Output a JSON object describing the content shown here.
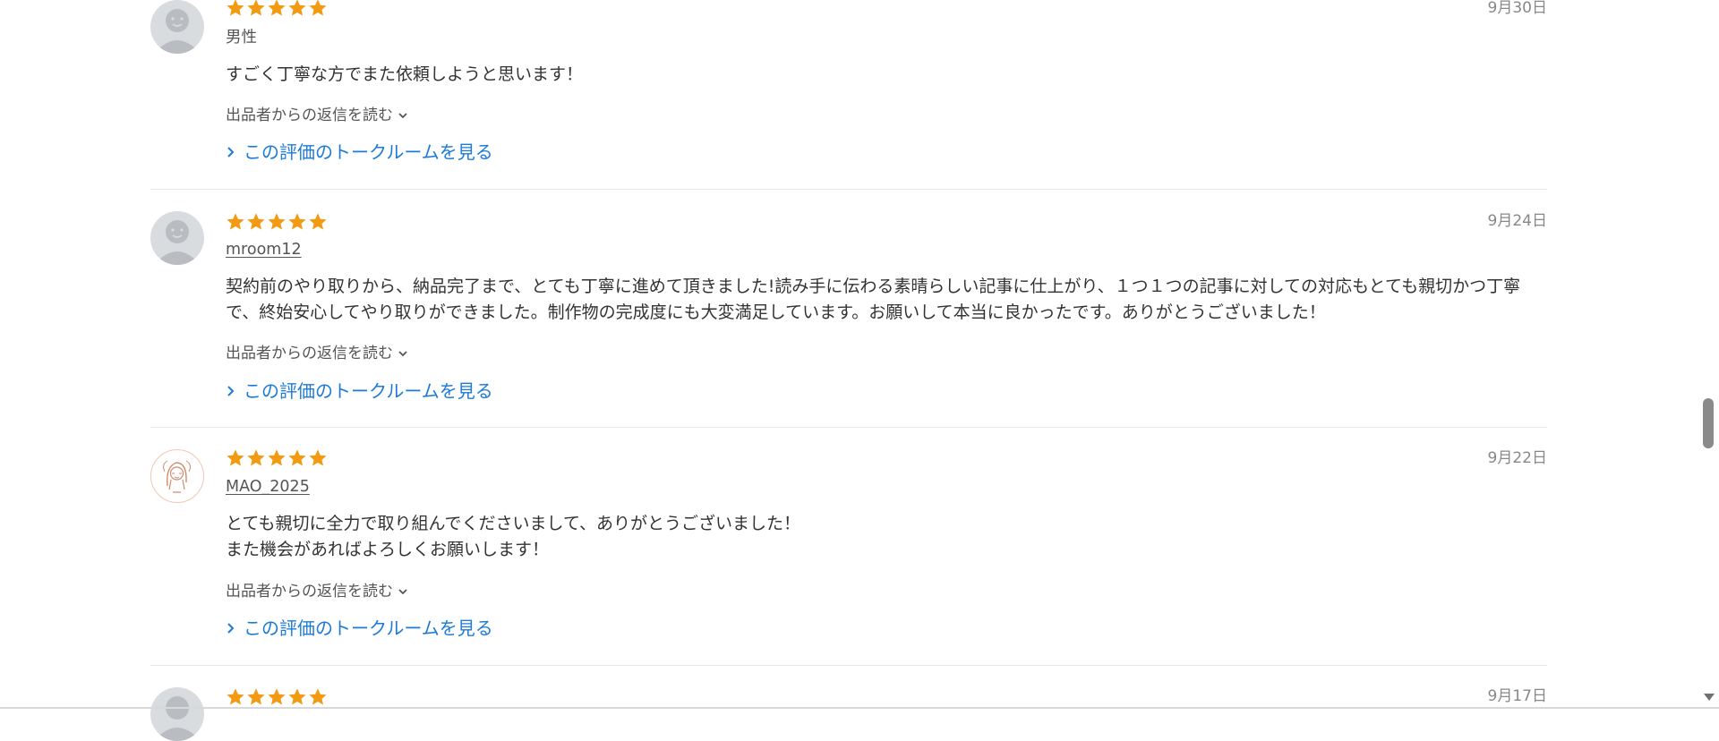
{
  "reviews": [
    {
      "user": "男性",
      "user_is_link": false,
      "date": "9月30日",
      "body": "すごく丁寧な方でまた依頼しようと思います！",
      "reply_label": "出品者からの返信を読む",
      "talk_label": "この評価のトークルームを見る",
      "rating": 5,
      "avatar": "default-avatar-icon"
    },
    {
      "user": "mroom12",
      "user_is_link": true,
      "date": "9月24日",
      "body": "契約前のやり取りから、納品完了まで、とても丁寧に進めて頂きました!読み手に伝わる素晴らしい記事に仕上がり、１つ１つの記事に対しての対応もとても親切かつ丁寧で、終始安心してやり取りができました。制作物の完成度にも大変満足しています。お願いして本当に良かったです。ありがとうございました！",
      "reply_label": "出品者からの返信を読む",
      "talk_label": "この評価のトークルームを見る",
      "rating": 5,
      "avatar": "default-avatar-icon"
    },
    {
      "user": "MAO_2025",
      "user_is_link": true,
      "date": "9月22日",
      "body": "とても親切に全力で取り組んでくださいまして、ありがとうございました！\nまた機会があればよろしくお願いします！",
      "reply_label": "出品者からの返信を読む",
      "talk_label": "この評価のトークルームを見る",
      "rating": 5,
      "avatar": "illustrated-avatar-icon"
    },
    {
      "date": "9月17日",
      "rating": 5,
      "avatar": "default-avatar-icon"
    }
  ],
  "colors": {
    "star": "#f29a12",
    "link": "#1d7bd6",
    "text": "#333333",
    "muted": "#888888",
    "separator": "#e6e6e6"
  }
}
